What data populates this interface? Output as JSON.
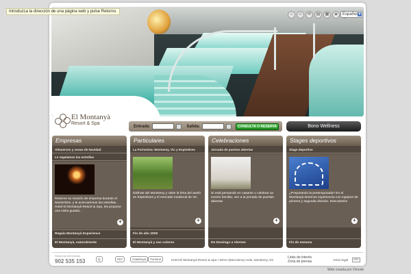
{
  "tooltip": "Introduzca la dirección de una página web y pulse Retorno.",
  "header": {
    "language": "Español",
    "top_icons": [
      "home-icon",
      "user-icon",
      "mail-icon",
      "print-icon",
      "calendar-icon",
      "map-icon",
      "info-icon"
    ]
  },
  "logo": {
    "name": "El Montanyà",
    "sub": "Resort & Spa"
  },
  "booking": {
    "entrada_label": "Entrada:",
    "salida_label": "Salida:",
    "entrada_value": "",
    "salida_value": "",
    "cta": "CONSULTA O RESERVA"
  },
  "bono_label": "Bono Wellness",
  "columns": [
    {
      "title": "Empresas",
      "top_rows": [
        "Almuerzos y cenas de Navidad",
        "Le regalamos las estrellas"
      ],
      "text": "Reserve su reunión de empresa durante el Noviembre, y le acercaremos las estrellas... Hotel El Montanyà Resort & Spa, les propone una visita guiada...",
      "foot_rows": [
        "Regala Montanyà Experience",
        "El Montanyà, naturalmente"
      ]
    },
    {
      "title": "Particulares",
      "top_rows": [
        "La Puríssima: Montseny, Vic y Espinelves"
      ],
      "text": "Disfrute del Montseny y visite la feria del avetó en Espinelves y el mercado medieval de Vic",
      "foot_rows": [
        "Fin de año 2008",
        "El Montanyà y sus colores"
      ]
    },
    {
      "title": "Celebraciones",
      "top_rows": [
        "Jornada de puertas abiertas"
      ],
      "text": "Si está pensando en casarse o celebrar un evento familiar, ven a la jornada de puertas abiertas",
      "foot_rows": [
        "De Domingo a Viernes"
      ]
    },
    {
      "title": "Stages deportivos",
      "top_rows": [
        "Stage deportivo"
      ],
      "text": "¿Preparando la pretemporada? En el Montanyà tenemos experiencia con equipos de primera y segunda división. Descubrelo!",
      "foot_rows": [
        "Fin de semana"
      ]
    }
  ],
  "footer": {
    "phone_label": "Reservas telefónicas",
    "phone": "902 535 153",
    "badges": [
      "Q",
      "ISO",
      "Catalunya",
      "Turisme"
    ],
    "address": "Hotel El Montanyà Resort & Spa • SEVA (Barcelona) Avda. Montseny, s/n",
    "links": [
      "Links de interés",
      "Zona de prensa"
    ],
    "aviso": "Aviso legal",
    "mini": "RSS"
  },
  "credit": "Web creada por Omodo"
}
